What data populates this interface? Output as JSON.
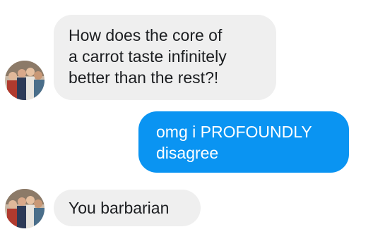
{
  "messages": [
    {
      "direction": "incoming",
      "text": "How does the core of\na carrot taste infinitely\nbetter than the rest?!",
      "show_avatar": true
    },
    {
      "direction": "outgoing",
      "text": "omg i PROFOUNDLY\ndisagree",
      "show_avatar": false
    },
    {
      "direction": "incoming",
      "text": "You barbarian",
      "show_avatar": true
    }
  ],
  "colors": {
    "incoming_bubble": "#efefef",
    "incoming_text": "#1c1e21",
    "outgoing_bubble": "#0a94f2",
    "outgoing_text": "#ffffff",
    "background": "#ffffff"
  },
  "icons": {
    "avatar": "group-photo-avatar"
  }
}
